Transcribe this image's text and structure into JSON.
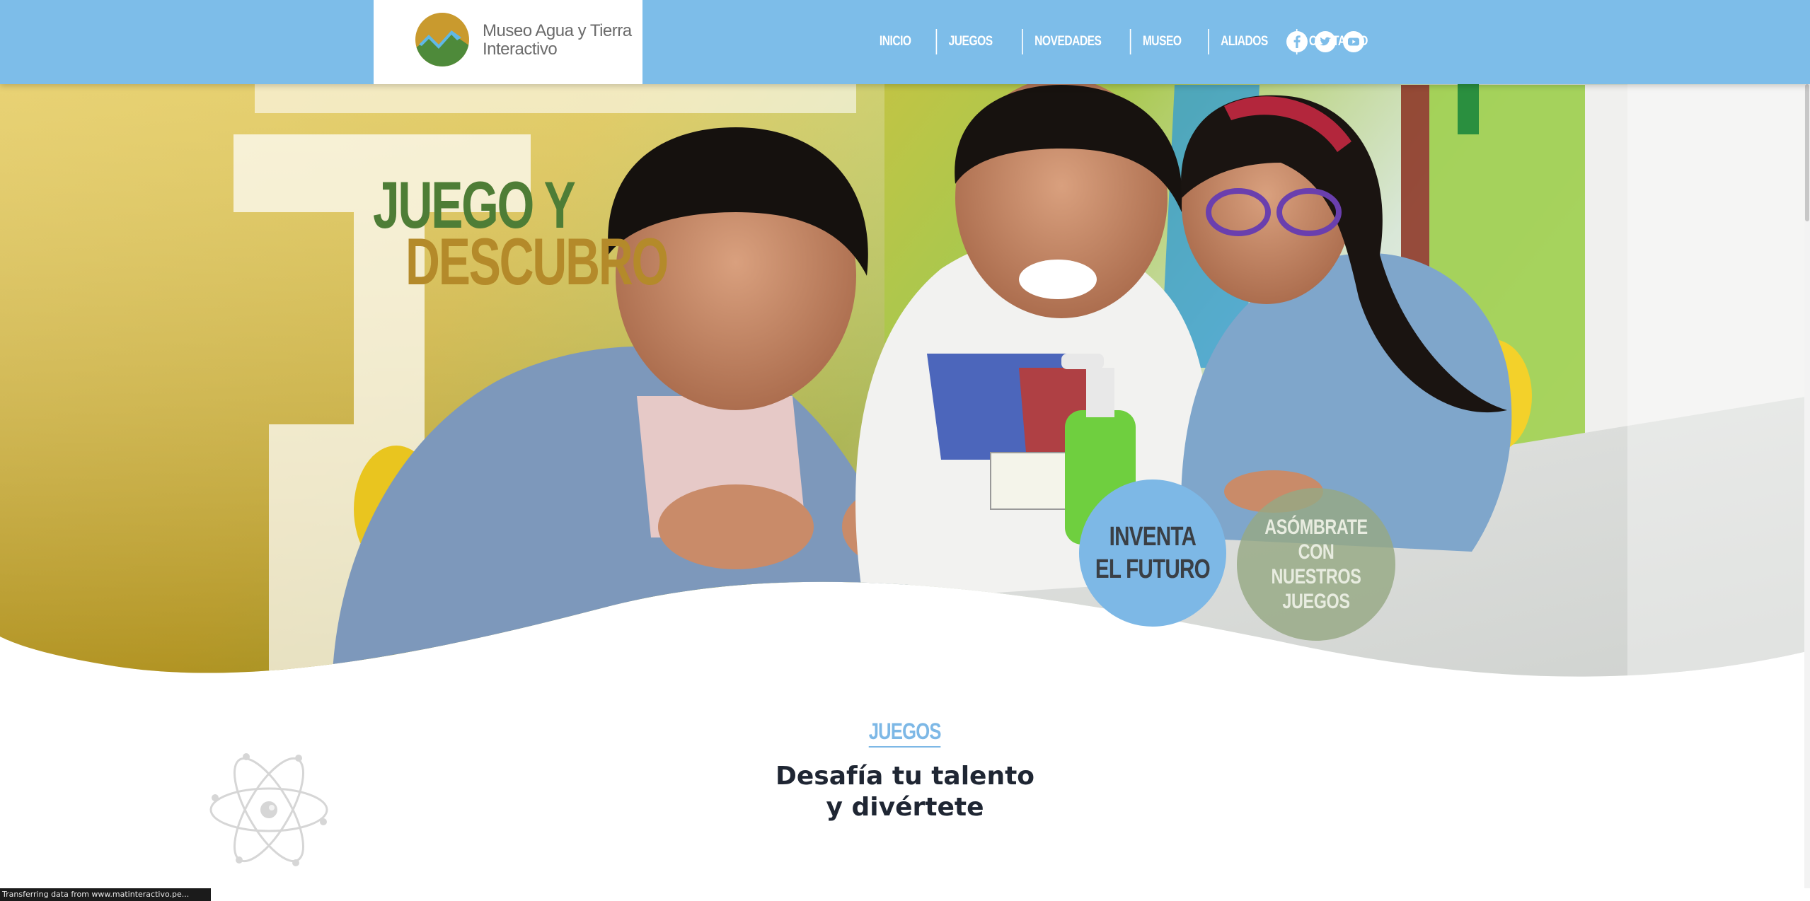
{
  "site": {
    "logo_line1": "Museo Agua y Tierra",
    "logo_line2": "Interactivo"
  },
  "nav": {
    "items": [
      {
        "label": "INICIO"
      },
      {
        "label": "JUEGOS"
      },
      {
        "label": "NOVEDADES"
      },
      {
        "label": "MUSEO"
      },
      {
        "label": "ALIADOS"
      },
      {
        "label": "CONTACTO"
      }
    ],
    "social": [
      {
        "icon": "facebook-icon"
      },
      {
        "icon": "twitter-icon"
      },
      {
        "icon": "youtube-icon"
      }
    ]
  },
  "hero": {
    "headline_line1": "JUEGO Y",
    "headline_line2": "DESCUBRO",
    "button_primary_line1": "INVENTA",
    "button_primary_line2": "EL FUTURO",
    "button_secondary_line1": "ASÓMBRATE",
    "button_secondary_line2": "CON NUESTROS",
    "button_secondary_line3": "JUEGOS"
  },
  "games": {
    "label": "JUEGOS",
    "title_line1": "Desafía tu talento",
    "title_line2": "y divértete"
  },
  "status": {
    "text": "Transferring data from www.matinteractivo.pe..."
  },
  "colors": {
    "header_bg": "#7dbde9",
    "headline_green": "#4e7d36",
    "headline_gold": "#b48a2a",
    "button_blue": "#7db8e6",
    "button_sage": "#96a884"
  }
}
